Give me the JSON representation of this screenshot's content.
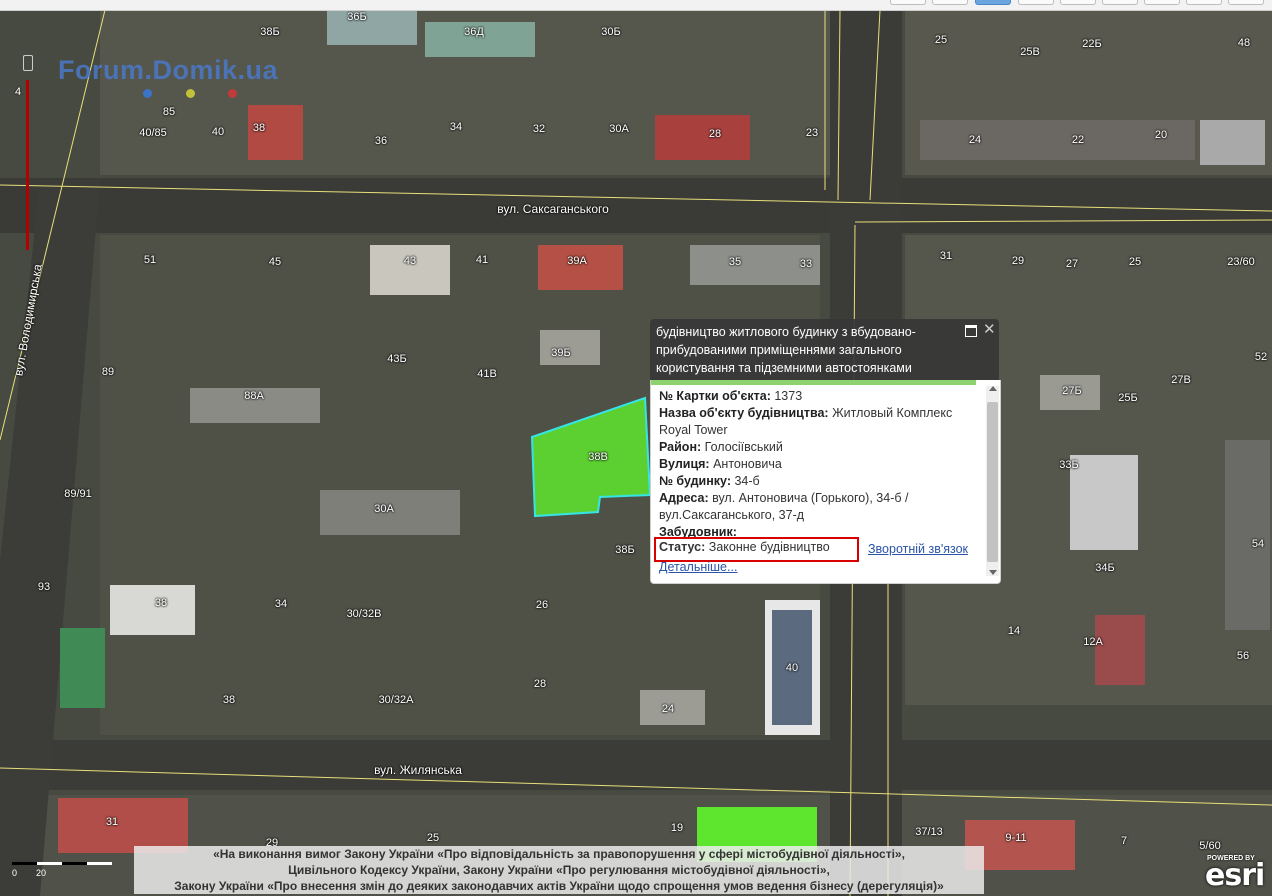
{
  "map": {
    "watermark": "Forum.Domik.ua",
    "zoom_value": "4",
    "streets": [
      {
        "label": "вул. Саксаганського"
      },
      {
        "label": "вул. Жилянська"
      },
      {
        "label": "вул. Володимирська"
      }
    ],
    "building_numbers": [
      "36Б",
      "38Б",
      "36Д",
      "30Б",
      "25",
      "25В",
      "22Б",
      "48",
      "85",
      "40/85",
      "40",
      "38",
      "36",
      "34",
      "32",
      "30А",
      "28",
      "23",
      "24",
      "22",
      "20",
      "51",
      "45",
      "43",
      "41",
      "39А",
      "35",
      "33",
      "31",
      "29",
      "27",
      "25",
      "23/60",
      "43Б",
      "41В",
      "39Б",
      "89",
      "88А",
      "38В",
      "27Б",
      "25Б",
      "27В",
      "52",
      "89/91",
      "30А",
      "33Б",
      "34Б",
      "54",
      "93",
      "38",
      "34",
      "30/32В",
      "26",
      "38Б",
      "14",
      "12А",
      "56",
      "38",
      "30/32А",
      "28",
      "40",
      "24",
      "31",
      "29",
      "25",
      "19",
      "37/13",
      "9-11",
      "7",
      "5/60"
    ],
    "selected_parcel_color": "#5ee62e",
    "scalebar_labels": [
      "0",
      "20"
    ]
  },
  "popup": {
    "title": "будівництво житлового будинку з вбудовано-прибудованими приміщеннями загального користування та підземними автостоянками",
    "fields": [
      {
        "label": "№ Картки об'єкта:",
        "value": "1373"
      },
      {
        "label": "Назва об'єкту будівництва:",
        "value": "Житловый Комплекс Royal Tower"
      },
      {
        "label": "Район:",
        "value": "Голосіївський"
      },
      {
        "label": "Вулиця:",
        "value": "Антоновича"
      },
      {
        "label": "№ будинку:",
        "value": "34-б"
      },
      {
        "label": "Адреса:",
        "value": "вул. Антоновича (Горького), 34-б / вул.Саксаганського, 37-д"
      },
      {
        "label": "Забудовник:",
        "value": ""
      }
    ],
    "status_label": "Статус:",
    "status_value": "Законне будівництво",
    "feedback_link": "Зворотній зв'язок",
    "more_link": "Детальніше..."
  },
  "disclaimer": {
    "line1": "«На виконання вимог Закону України «Про відповідальність за правопорушення у сфері містобудівної діяльності»,",
    "line2": "Цивільного Кодексу України, Закону України «Про регулювання містобудівної діяльності»,",
    "line3": "Закону України «Про внесення змін до деяких законодавчих актів України щодо спрощення умов ведення бізнесу (дерегуляція)»"
  },
  "branding": {
    "powered_by": "POWERED BY",
    "logo": "esri"
  },
  "colors": {
    "parcel_line": "#e8e07a",
    "status_highlight": "#d90000",
    "link": "#2a54a8"
  }
}
